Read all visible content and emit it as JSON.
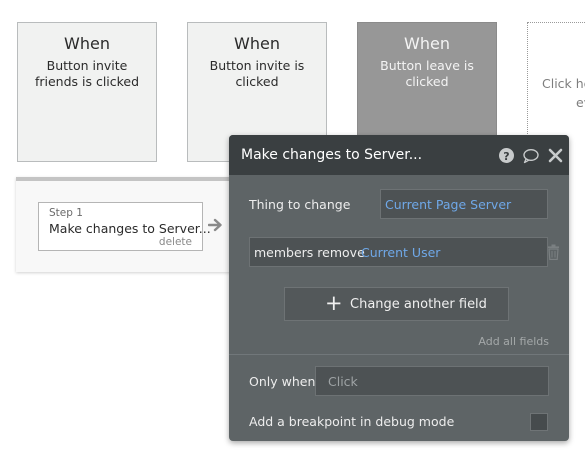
{
  "events": [
    {
      "when": "When",
      "description": "Button invite friends is clicked"
    },
    {
      "when": "When",
      "description": "Button invite is clicked"
    },
    {
      "when": "When",
      "description": "Button leave is clicked"
    }
  ],
  "new_event": {
    "line1": "Click he",
    "line2": "ev"
  },
  "workflow": {
    "step": {
      "number": "Step 1",
      "title": "Make changes to Server...",
      "delete_label": "delete"
    }
  },
  "panel": {
    "title": "Make changes to Server...",
    "icons": [
      "help-icon",
      "comment-icon",
      "close-icon"
    ],
    "thing_to_change_label": "Thing to change",
    "thing_to_change_value": "Current Page Server",
    "fields": [
      {
        "name": "members remove",
        "value": "Current User"
      }
    ],
    "change_another_field_label": "Change another field",
    "add_all_fields_label": "Add all fields",
    "only_when_label": "Only when",
    "only_when_placeholder": "Click",
    "breakpoint_label": "Add a breakpoint in debug mode"
  },
  "colors": {
    "panel_bg": "#5e6466",
    "panel_header": "#3a3f41",
    "link_blue": "#6fa8e8",
    "selected_event": "#979797"
  }
}
